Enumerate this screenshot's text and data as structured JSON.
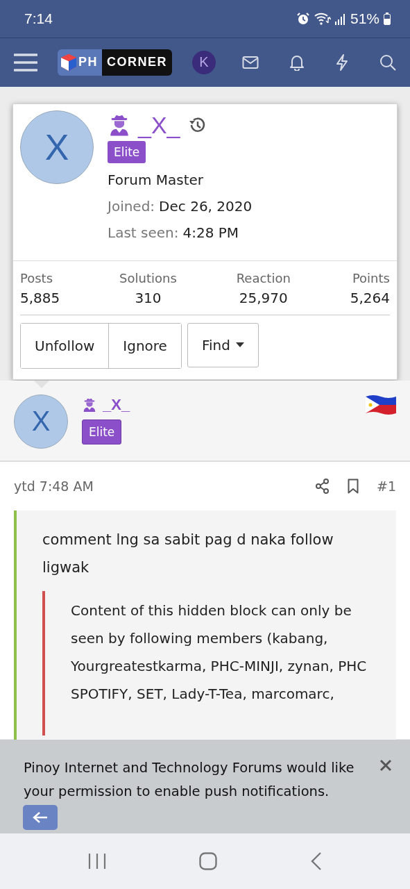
{
  "status_bar": {
    "time": "7:14",
    "battery": "51%"
  },
  "nav": {
    "logo_left": "PH",
    "logo_right": "CORNER",
    "avatar_letter": "K"
  },
  "profile_card": {
    "avatar_letter": "X",
    "username": "_X_",
    "badge": "Elite",
    "title": "Forum Master",
    "fields": [
      {
        "label": "Joined:",
        "value": "Dec 26, 2020"
      },
      {
        "label": "Last seen:",
        "value": "4:28 PM"
      }
    ],
    "stats": [
      {
        "label": "Posts",
        "value": "5,885"
      },
      {
        "label": "Solutions",
        "value": "310"
      },
      {
        "label": "Reaction",
        "value": "25,970"
      },
      {
        "label": "Points",
        "value": "5,264"
      }
    ],
    "buttons": [
      {
        "label": "Unfollow",
        "kind": "joined"
      },
      {
        "label": "Ignore",
        "kind": "joined"
      },
      {
        "label": "Find",
        "kind": "dropdown"
      }
    ]
  },
  "post": {
    "user": {
      "avatar_letter": "X",
      "username": "_X_",
      "badge": "Elite"
    },
    "time": "ytd 7:48 AM",
    "number": "#1",
    "message": "comment lng sa sabit pag d naka follow ligwak",
    "hidden_block": "Content of this hidden block can only be seen by following members (kabang, Yourgreatestkarma, PHC-MINJI, zynan, PHC SPOTIFY, SET, Lady-T-Tea, marcomarc,"
  },
  "push_banner": {
    "message": "Pinoy Internet and Technology Forums would like your permission to enable push notifications."
  }
}
